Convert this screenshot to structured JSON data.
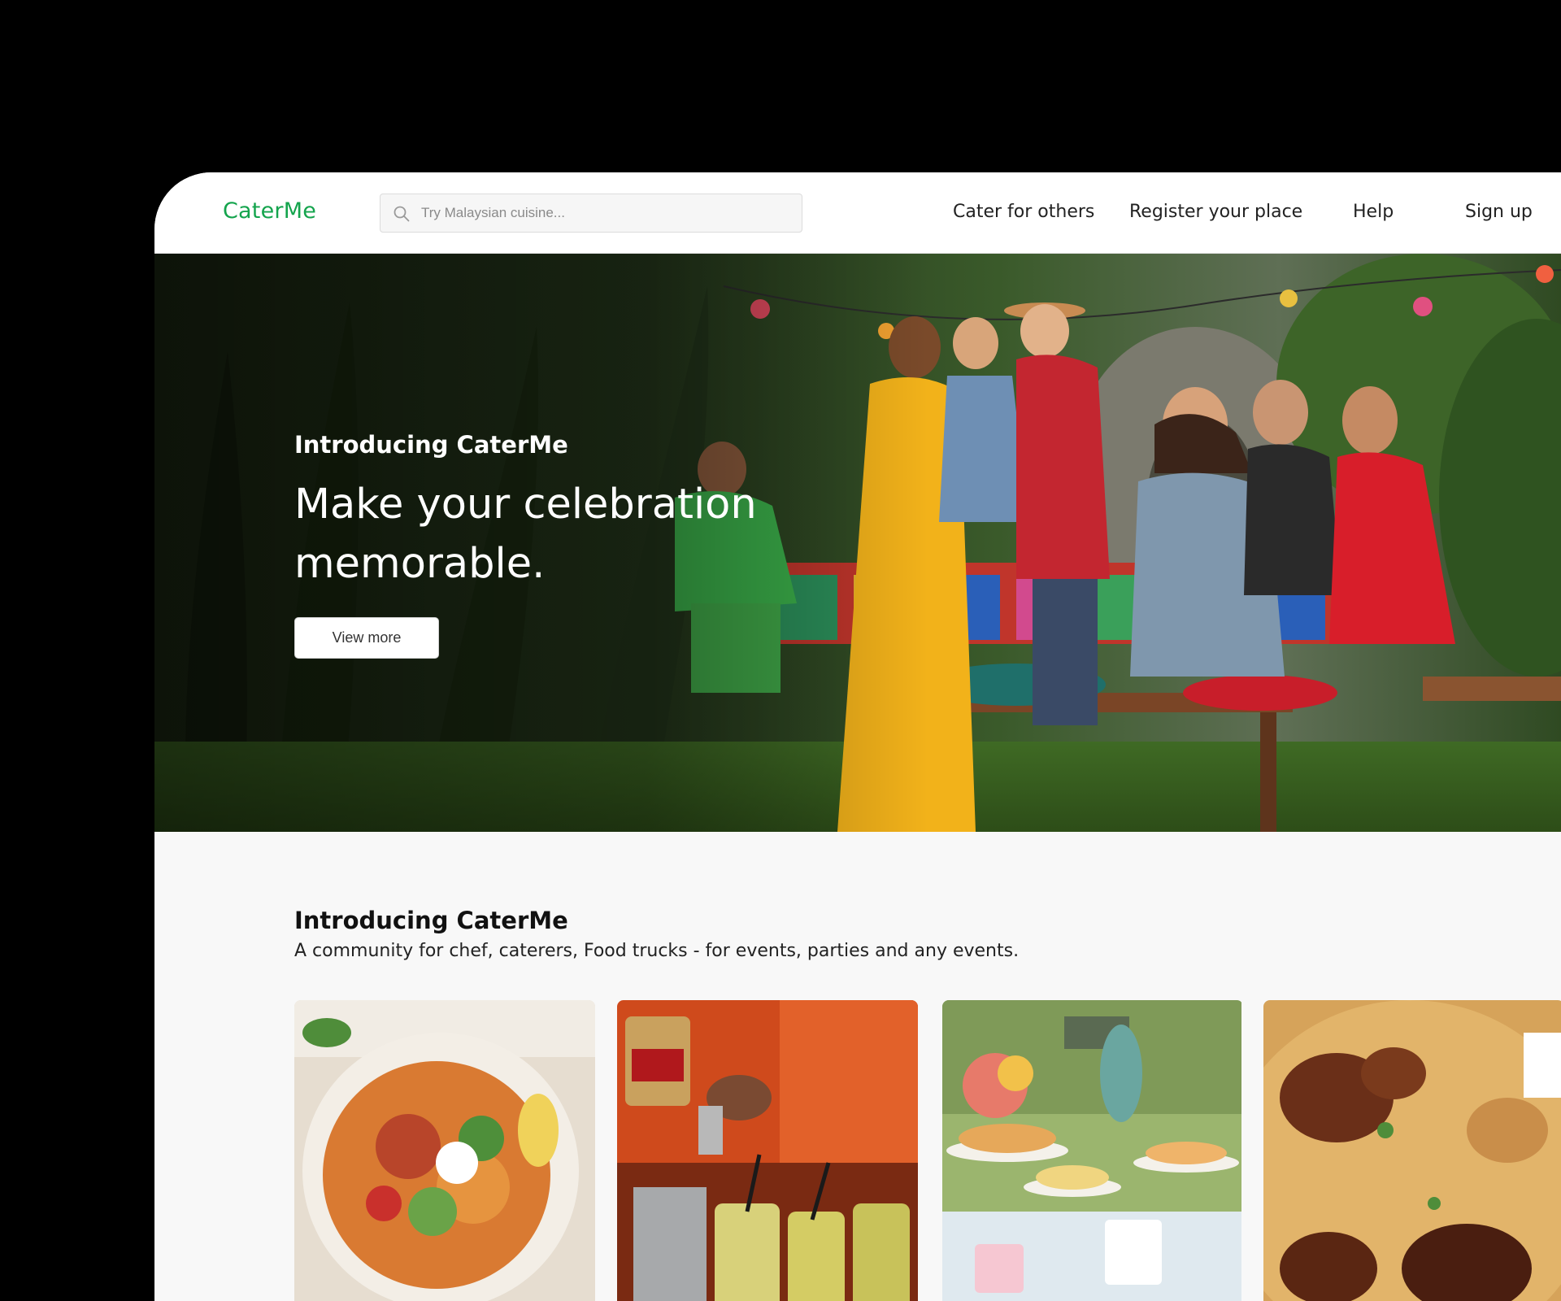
{
  "header": {
    "logo": "CaterMe",
    "search": {
      "placeholder": "Try Malaysian cuisine...",
      "value": ""
    },
    "nav": [
      {
        "label": "Cater for others"
      },
      {
        "label": "Register your place"
      },
      {
        "label": "Help"
      },
      {
        "label": "Sign up"
      }
    ]
  },
  "hero": {
    "image": "outdoor-dinner-party-photo",
    "eyebrow": "Introducing CaterMe",
    "headline": "Make your celebration memorable.",
    "cta_label": "View more"
  },
  "intro": {
    "title": "Introducing CaterMe",
    "subtitle": "A community for chef, caterers, Food trucks - for events, parties and any events."
  },
  "cards": [
    {
      "image": "sweet-potato-salad-bowl-photo"
    },
    {
      "image": "cocktail-bar-photo"
    },
    {
      "image": "garden-dessert-table-photo"
    },
    {
      "image": "chicken-biryani-photo"
    }
  ],
  "colors": {
    "brand": "#14a44d",
    "page_background": "#f8f8f8",
    "outer_background": "#000000"
  }
}
